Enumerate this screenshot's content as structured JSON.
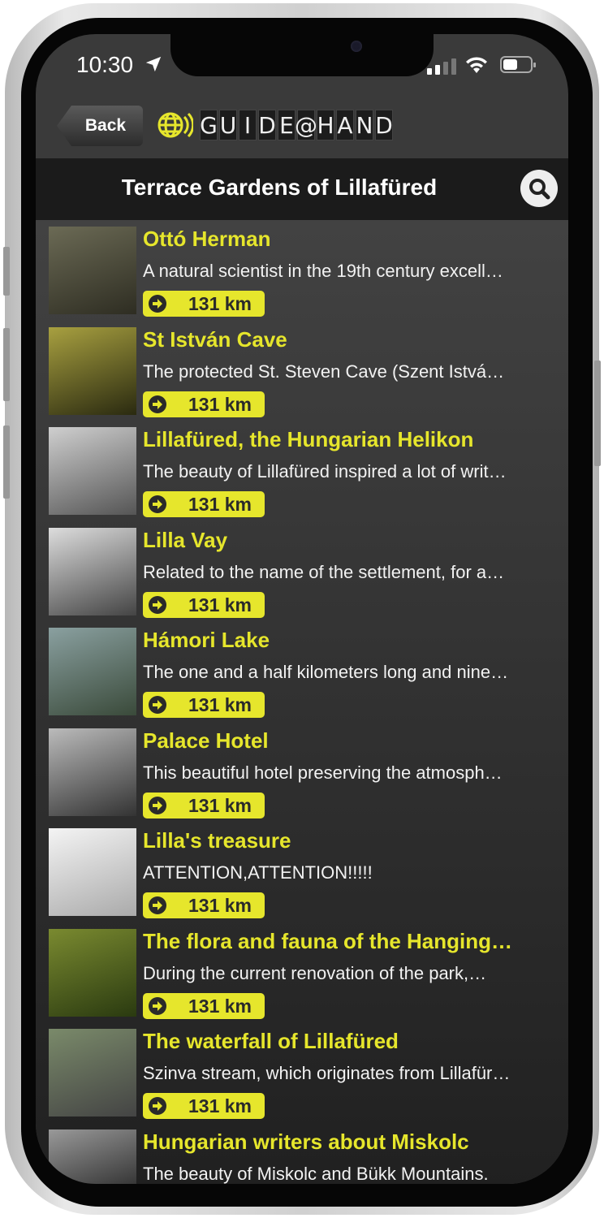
{
  "status": {
    "time": "10:30"
  },
  "header": {
    "back_label": "Back",
    "logo_text": "GUIDE@HAND",
    "title": "Terrace Gardens of Lillafüred"
  },
  "colors": {
    "accent": "#e6e62c",
    "header_bg": "#3a3a3a",
    "titlebar_bg": "#1b1b1b"
  },
  "items": [
    {
      "title": "Ottó Herman",
      "desc": "A natural scientist in the 19th century excell…",
      "distance": "131 km",
      "thumb": [
        "#6b6a55",
        "#2e2d22"
      ]
    },
    {
      "title": "St István Cave",
      "desc": " The protected St. Steven Cave (Szent Istvá…",
      "distance": "131 km",
      "thumb": [
        "#a8a040",
        "#2a2a10"
      ]
    },
    {
      "title": "Lillafüred, the Hungarian Helikon",
      "desc": "The beauty of Lillafüred inspired a lot of writ…",
      "distance": "131 km",
      "thumb": [
        "#cfcfcf",
        "#555"
      ]
    },
    {
      "title": "Lilla Vay",
      "desc": "Related to the name of the settlement, for a…",
      "distance": "131 km",
      "thumb": [
        "#ddd",
        "#444"
      ]
    },
    {
      "title": "Hámori Lake",
      "desc": "The one and a half kilometers long and nine…",
      "distance": "131 km",
      "thumb": [
        "#8aa0a0",
        "#3a4a3a"
      ]
    },
    {
      "title": "Palace Hotel",
      "desc": "This beautiful hotel preserving the atmosph…",
      "distance": "131 km",
      "thumb": [
        "#bbb",
        "#333"
      ]
    },
    {
      "title": "Lilla's treasure",
      "desc": "ATTENTION,ATTENTION!!!!!",
      "distance": "131 km",
      "thumb": [
        "#f4f4f4",
        "#aaa"
      ]
    },
    {
      "title": "The flora and fauna of the Hanging…",
      "desc": "During the current  renovation of the park,…",
      "distance": "131 km",
      "thumb": [
        "#7a8a30",
        "#2a3a10"
      ]
    },
    {
      "title": "The waterfall of Lillafüred",
      "desc": "Szinva stream, which originates from Lillafür…",
      "distance": "131 km",
      "thumb": [
        "#7a8a6a",
        "#444"
      ]
    },
    {
      "title": "Hungarian writers about Miskolc",
      "desc": "The beauty of Miskolc and Bükk Mountains.",
      "thumb": [
        "#999",
        "#111"
      ]
    }
  ]
}
